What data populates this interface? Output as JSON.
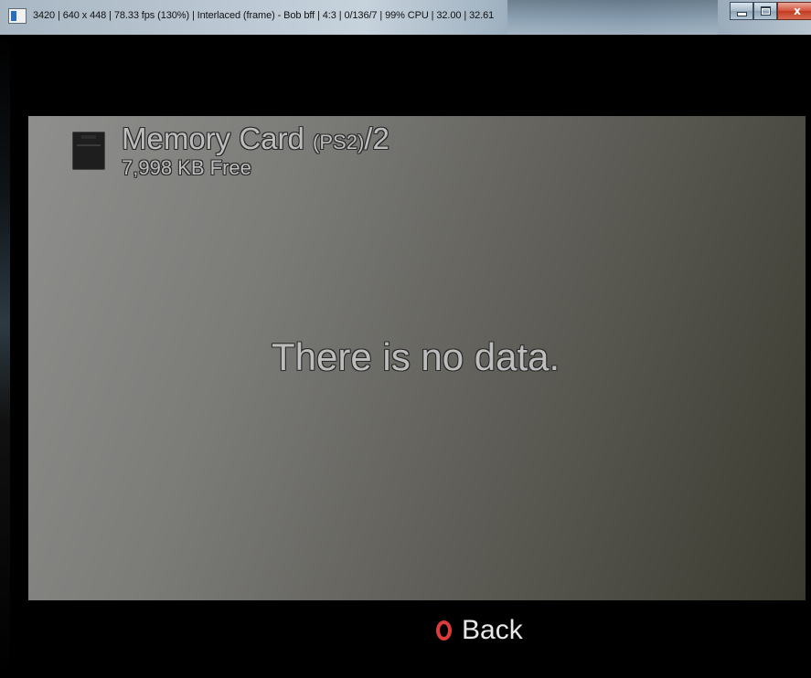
{
  "window": {
    "title": "3420 | 640 x 448 | 78.33 fps (130%) | Interlaced (frame) - Bob bff | 4:3 | 0/136/7 | 99% CPU | 32.00 | 32.61",
    "controls": {
      "minimize": "",
      "maximize": "",
      "close": "x"
    }
  },
  "memory_card": {
    "title": "Memory Card ",
    "title_sub": "(PS2)",
    "title_slot": "/2",
    "free_space": "7,998 KB Free"
  },
  "message": "There is no data.",
  "footer": {
    "back_label": "Back",
    "back_button_color": "#e03b3b"
  },
  "icons": {
    "app": "app-window-icon",
    "card": "memory-card-icon",
    "circle": "circle-button-icon"
  }
}
